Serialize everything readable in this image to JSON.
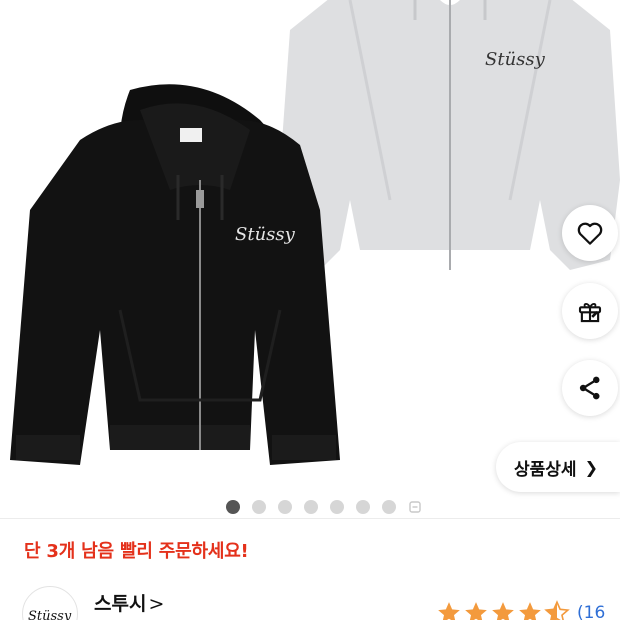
{
  "product": {
    "detail_button_label": "상품상세",
    "stock_message": "단 3개 남음 빨리 주문하세요!",
    "logo_text_grey": "Stüssy",
    "logo_text_black": "Stüssy"
  },
  "carousel": {
    "total_dots": 7,
    "active_index": 0
  },
  "brand": {
    "name": "스투시",
    "chevron": ">",
    "logo_text": "Stüssy"
  },
  "rating": {
    "value": 4.5,
    "review_count": "(16"
  },
  "colors": {
    "accent_red": "#e4311b",
    "star": "#f39a3d",
    "link_blue": "#2f6fd6",
    "hoodie_black": "#121212",
    "hoodie_grey": "#dedfe1"
  },
  "icons": {
    "like": "heart-icon",
    "gift": "gift-icon",
    "share": "share-icon",
    "detail": "chevron-right-icon",
    "more": "more-dots-icon"
  }
}
